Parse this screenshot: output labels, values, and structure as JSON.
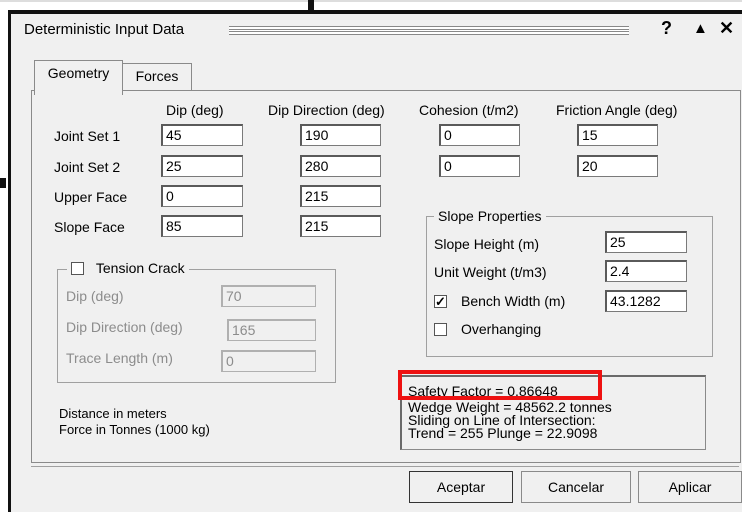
{
  "window": {
    "title": "Deterministic Input Data",
    "help_glyph": "?",
    "minimize_glyph": "▲",
    "close_glyph": "✕"
  },
  "tabs": [
    {
      "label": "Geometry",
      "active": true
    },
    {
      "label": "Forces",
      "active": false
    }
  ],
  "geometry": {
    "column_headers": [
      "Dip (deg)",
      "Dip Direction (deg)",
      "Cohesion (t/m2)",
      "Friction Angle (deg)"
    ],
    "rows": [
      {
        "label": "Joint Set 1",
        "dip": "45",
        "dip_direction": "190",
        "cohesion": "0",
        "friction_angle": "15"
      },
      {
        "label": "Joint Set 2",
        "dip": "25",
        "dip_direction": "280",
        "cohesion": "0",
        "friction_angle": "20"
      },
      {
        "label": "Upper Face",
        "dip": "0",
        "dip_direction": "215"
      },
      {
        "label": "Slope Face",
        "dip": "85",
        "dip_direction": "215"
      }
    ]
  },
  "tension_crack": {
    "label": "Tension Crack",
    "checked": false,
    "fields": [
      {
        "label": "Dip (deg)",
        "value": "70"
      },
      {
        "label": "Dip Direction (deg)",
        "value": "165"
      },
      {
        "label": "Trace Length (m)",
        "value": "0"
      }
    ]
  },
  "slope_properties": {
    "title": "Slope Properties",
    "slope_height_label": "Slope Height (m)",
    "slope_height": "25",
    "unit_weight_label": "Unit Weight (t/m3)",
    "unit_weight": "2.4",
    "bench_width_label": "Bench Width (m)",
    "bench_width": "43.1282",
    "bench_width_checked": true,
    "overhanging_label": "Overhanging",
    "overhanging_checked": false
  },
  "units_note": {
    "distance": "Distance in meters",
    "force": "Force in Tonnes (1000 kg)"
  },
  "results": {
    "lines": [
      "Safety Factor = 0.86648",
      "Wedge Weight = 48562.2 tonnes",
      "Sliding on Line of Intersection:",
      "Trend = 255 Plunge = 22.9098"
    ],
    "highlight_color": "#ee1111"
  },
  "buttons": {
    "accept": "Aceptar",
    "cancel": "Cancelar",
    "apply": "Aplicar"
  }
}
